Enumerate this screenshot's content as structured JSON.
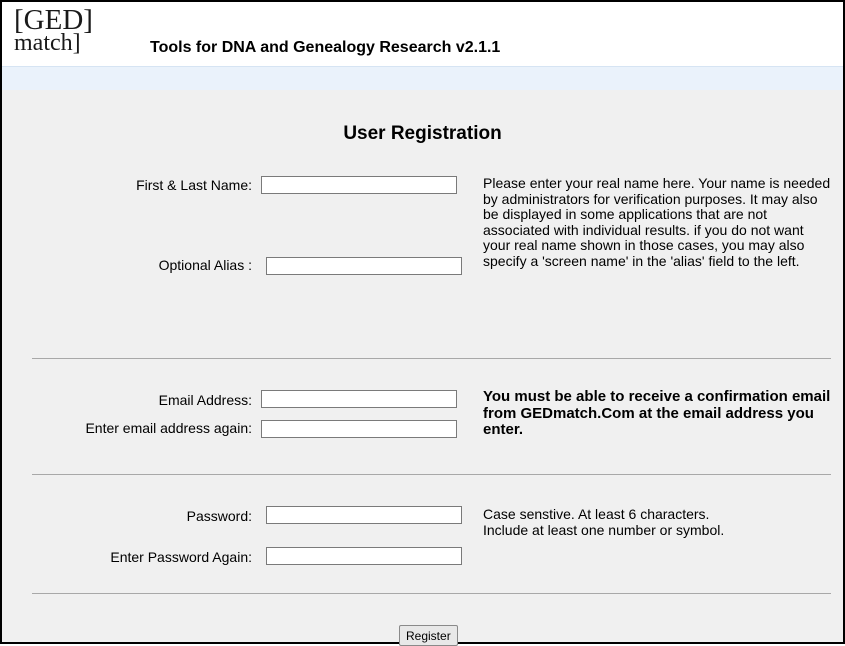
{
  "header": {
    "logo_line1": "[GED]",
    "logo_line2": "match]",
    "tagline": "Tools for DNA and Genealogy Research v2.1.1"
  },
  "form": {
    "title": "User Registration",
    "name_section": {
      "first_last_label": "First & Last Name:",
      "first_last_value": "",
      "alias_label": "Optional Alias :",
      "alias_value": "",
      "help": "Please enter your real name here. Your name is needed by administrators for verification purposes. It may also be displayed in some applications that are not associated with individual results. if you do not want your real name shown in those cases, you may also specify a 'screen name' in the 'alias' field to the left."
    },
    "email_section": {
      "email_label": "Email Address:",
      "email_value": "",
      "email_again_label": "Enter email address again:",
      "email_again_value": "",
      "help": "You must be able to receive a confirmation email from GEDmatch.Com at the email address you enter."
    },
    "password_section": {
      "password_label": "Password:",
      "password_value": "",
      "password_again_label": "Enter Password Again:",
      "password_again_value": "",
      "help_line1": "Case senstive. At least 6 characters.",
      "help_line2": "Include at least one number or symbol."
    },
    "register_label": "Register"
  }
}
